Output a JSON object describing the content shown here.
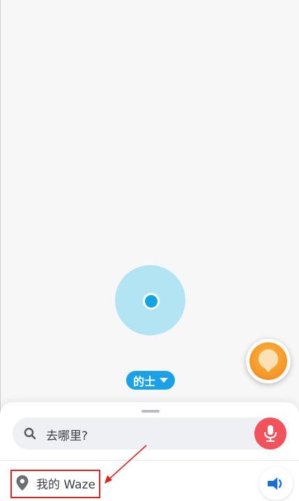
{
  "map": {
    "mode_chip": {
      "label": "的士"
    }
  },
  "bottom_sheet": {
    "search": {
      "placeholder": "去哪里?"
    },
    "my_waze": {
      "label": "我的 Waze"
    }
  },
  "colors": {
    "accent_blue": "#1aa1e6",
    "mic_red": "#f2535a",
    "fab_orange": "#f59a2a",
    "annotation_red": "#e0201c"
  },
  "icons": {
    "search": "search-icon",
    "mic": "microphone-icon",
    "location_pin": "location-pin-icon",
    "sound": "speaker-icon",
    "fab": "waze-mood-icon"
  }
}
